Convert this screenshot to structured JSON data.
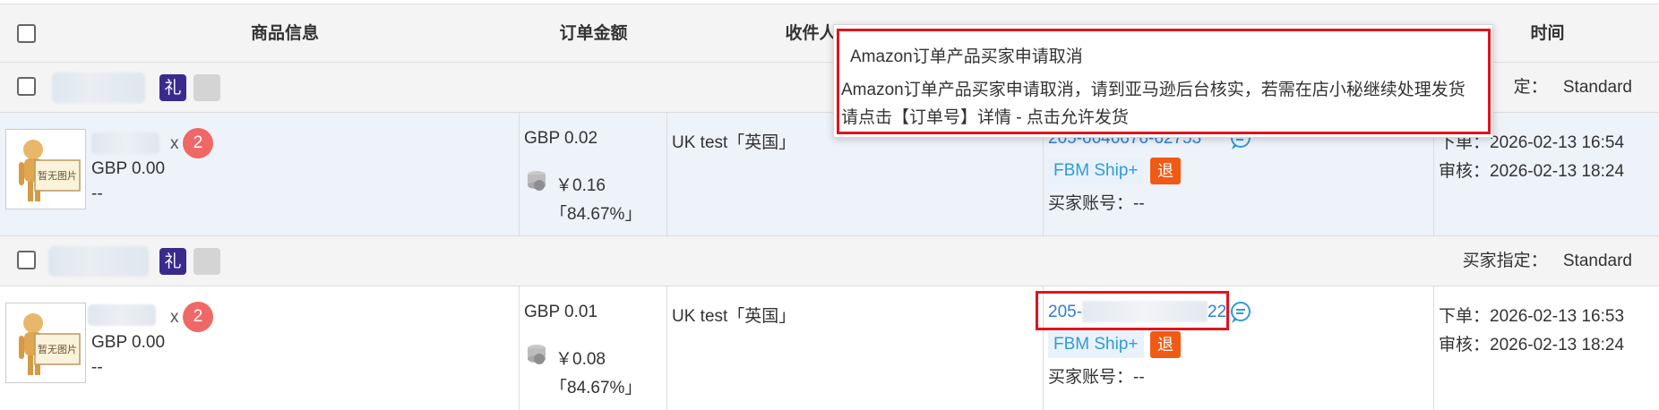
{
  "header": {
    "product_info": "商品信息",
    "order_amount": "订单金额",
    "recipient": "收件人",
    "time": "时间"
  },
  "groups": [
    {
      "buyer_spec_label": "定：",
      "buyer_spec_value": "Standard",
      "gift_icon": "礼"
    },
    {
      "buyer_spec_label": "买家指定：",
      "buyer_spec_value": "Standard",
      "gift_icon": "礼"
    }
  ],
  "orders": [
    {
      "image_label": "暂无图片",
      "qty_prefix": "x",
      "qty": "2",
      "unit_price": "GBP 0.00",
      "sku_extra": "--",
      "amount": "GBP 0.02",
      "cost": "￥0.16",
      "margin": "「84.67%」",
      "recipient": "UK test「英国」",
      "order_no_start": "205-6646676-",
      "order_no_end": "62753",
      "ship_tag": "FBM Ship+",
      "refund_badge": "退",
      "buyer_account_label": "买家账号：",
      "buyer_account_value": "--",
      "placed_label": "下单：",
      "placed_time": "2026-02-13 16:54",
      "audit_label": "审核：",
      "audit_time": "2026-02-13 18:24"
    },
    {
      "image_label": "暂无图片",
      "qty_prefix": "x",
      "qty": "2",
      "unit_price": "GBP 0.00",
      "sku_extra": "--",
      "amount": "GBP 0.01",
      "cost": "￥0.08",
      "margin": "「84.67%」",
      "recipient": "UK test「英国」",
      "order_no_start": "205-",
      "order_no_end": "22",
      "ship_tag": "FBM Ship+",
      "refund_badge": "退",
      "buyer_account_label": "买家账号：",
      "buyer_account_value": "--",
      "placed_label": "下单：",
      "placed_time": "2026-02-13 16:53",
      "audit_label": "审核：",
      "audit_time": "2026-02-13 18:24"
    }
  ],
  "tooltip": {
    "title": "Amazon订单产品买家申请取消",
    "line1": "Amazon订单产品买家申请取消，请到亚马逊后台核实，若需在店小秘继续处理发货",
    "line2": "请点击【订单号】详情 - 点击允许发货"
  },
  "colors": {
    "header_bg": "#f4f4f4",
    "row_alt_bg": "#eef2f9",
    "link": "#2f7dd1",
    "qty_badge": "#f06767",
    "refund_badge": "#f05a14",
    "gift_badge": "#3b2a8e",
    "highlight": "#e0141e"
  },
  "icons": [
    "checkbox-icon",
    "gift-icon",
    "coin-icon",
    "chat-icon",
    "no-image-icon"
  ]
}
